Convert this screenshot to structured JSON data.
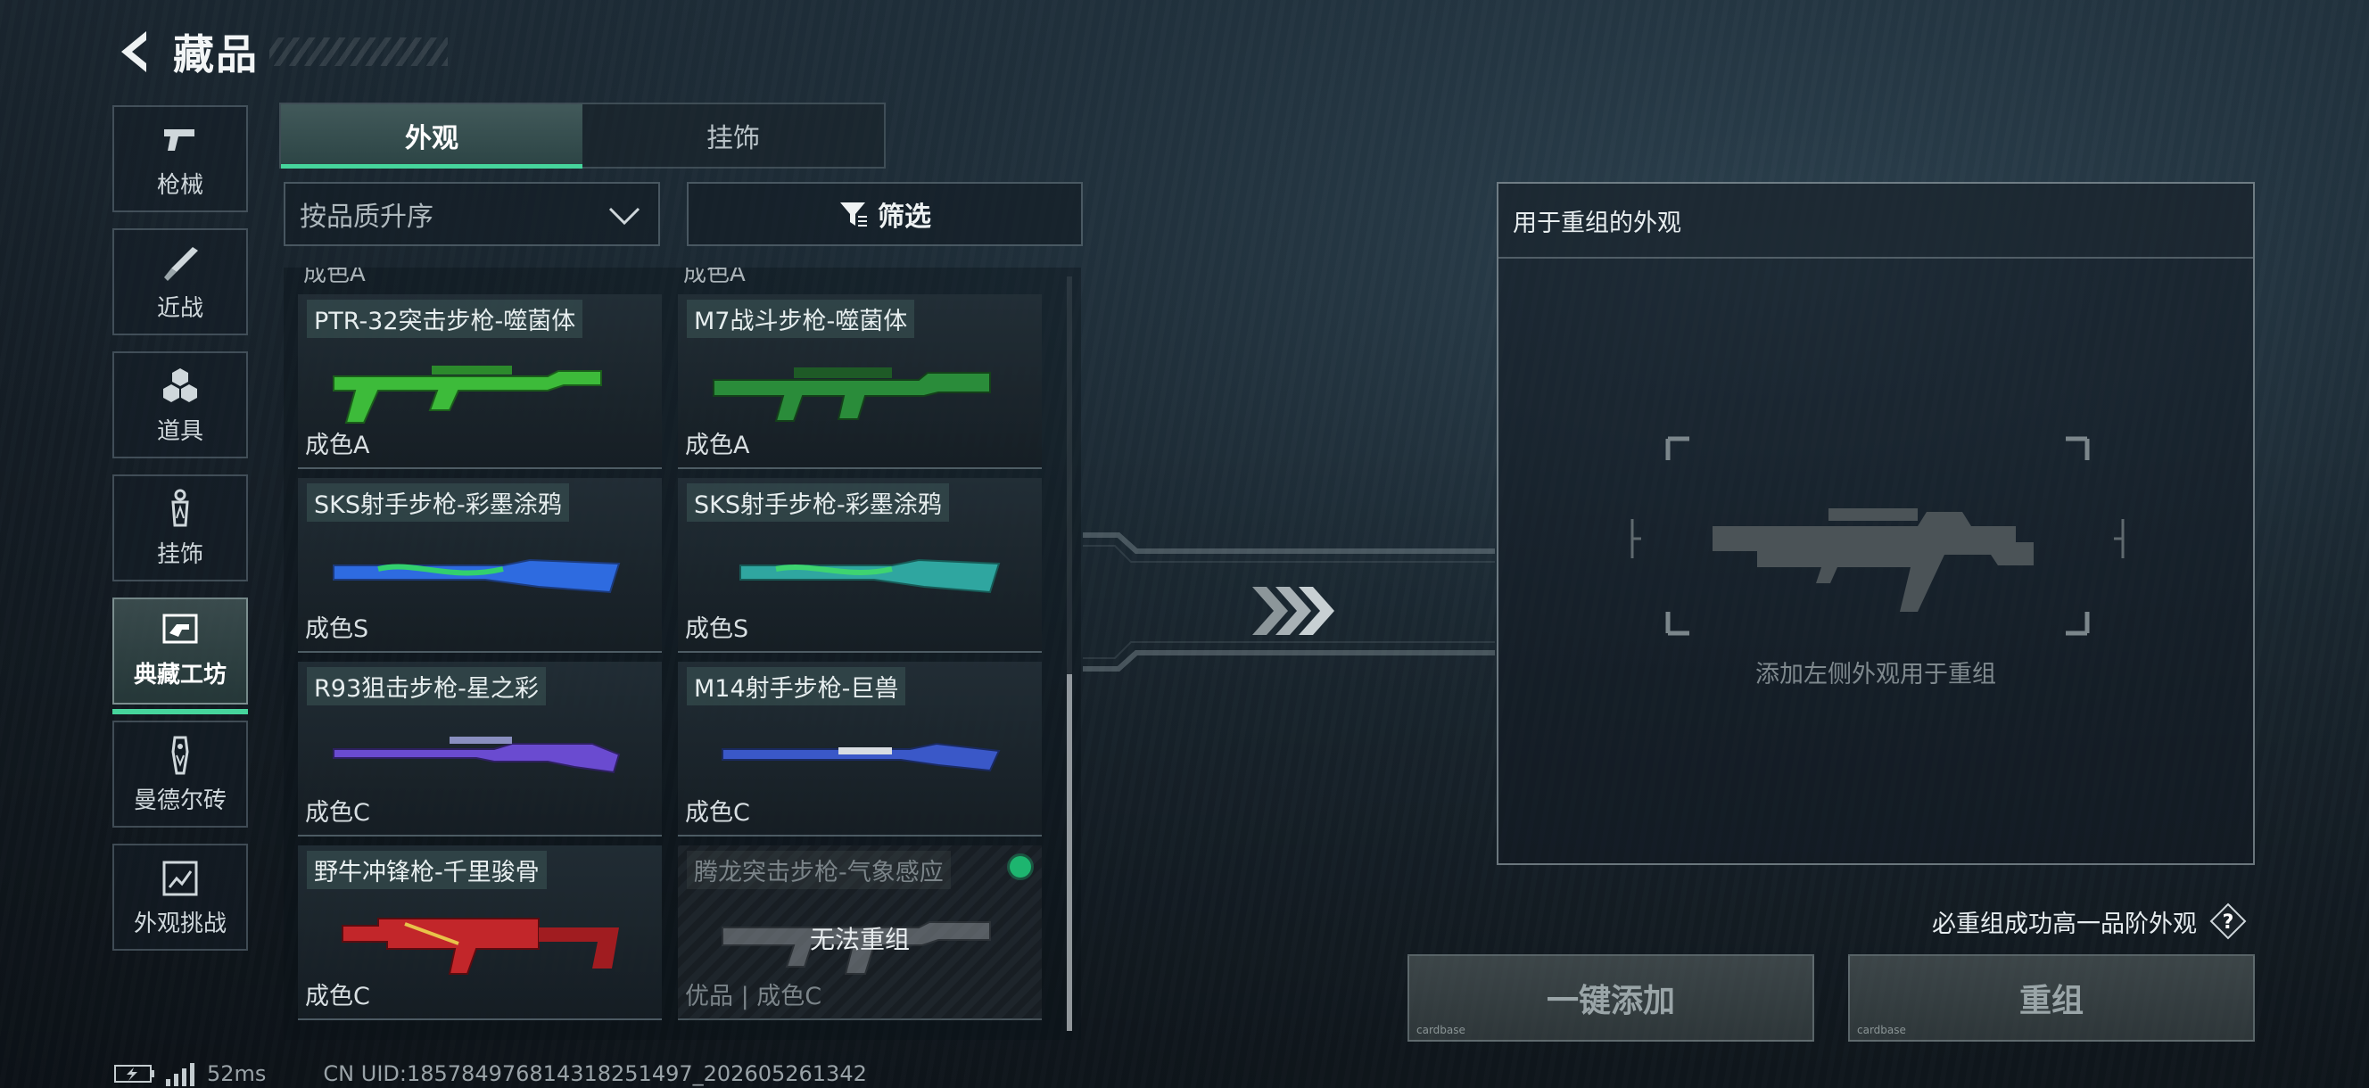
{
  "header": {
    "title": "藏品"
  },
  "nav": [
    {
      "label": "枪械",
      "icon": "pistol-icon"
    },
    {
      "label": "近战",
      "icon": "knife-icon"
    },
    {
      "label": "道具",
      "icon": "grenade-cluster-icon"
    },
    {
      "label": "挂饰",
      "icon": "charm-icon"
    },
    {
      "label": "典藏工坊",
      "icon": "workshop-icon",
      "active": true
    },
    {
      "label": "曼德尔砖",
      "icon": "mandel-brick-icon"
    },
    {
      "label": "外观挑战",
      "icon": "challenge-icon"
    }
  ],
  "tabs": [
    {
      "label": "外观",
      "active": true
    },
    {
      "label": "挂饰",
      "active": false
    }
  ],
  "sort": {
    "value": "按品质升序"
  },
  "filter": {
    "label": "筛选"
  },
  "partial_row": [
    "成色A",
    "成色A"
  ],
  "items": [
    {
      "name": "PTR-32突击步枪-噬菌体",
      "grade": "成色A",
      "color": "#3dbb3a"
    },
    {
      "name": "M7战斗步枪-噬菌体",
      "grade": "成色A",
      "color": "#2a8c3a"
    },
    {
      "name": "SKS射手步枪-彩墨涂鸦",
      "grade": "成色S",
      "color": "#2e6be0"
    },
    {
      "name": "SKS射手步枪-彩墨涂鸦",
      "grade": "成色S",
      "color": "#2fa6a0"
    },
    {
      "name": "R93狙击步枪-星之彩",
      "grade": "成色C",
      "color": "#6a4bd0"
    },
    {
      "name": "M14射手步枪-巨兽",
      "grade": "成色C",
      "color": "#3a58c8"
    },
    {
      "name": "野牛冲锋枪-千里骏骨",
      "grade": "成色C",
      "color": "#c2262a"
    },
    {
      "name": "腾龙突击步枪-气象感应",
      "grade": "优品 | 成色C",
      "color": "#6a7075",
      "disabled": true,
      "overlay": "无法重组",
      "selected": true
    }
  ],
  "regroup": {
    "header": "用于重组的外观",
    "hint": "添加左侧外观用于重组"
  },
  "note": {
    "text": "必重组成功高一品阶外观",
    "help": "?"
  },
  "buttons": {
    "add": "一键添加",
    "regroup": "重组",
    "tag": "cardbase"
  },
  "status": {
    "ping": "52ms",
    "uid": "CN UID:185784976814318251497_202605261342"
  },
  "colors": {
    "accent": "#46d59c",
    "selected": "#1db56f"
  }
}
